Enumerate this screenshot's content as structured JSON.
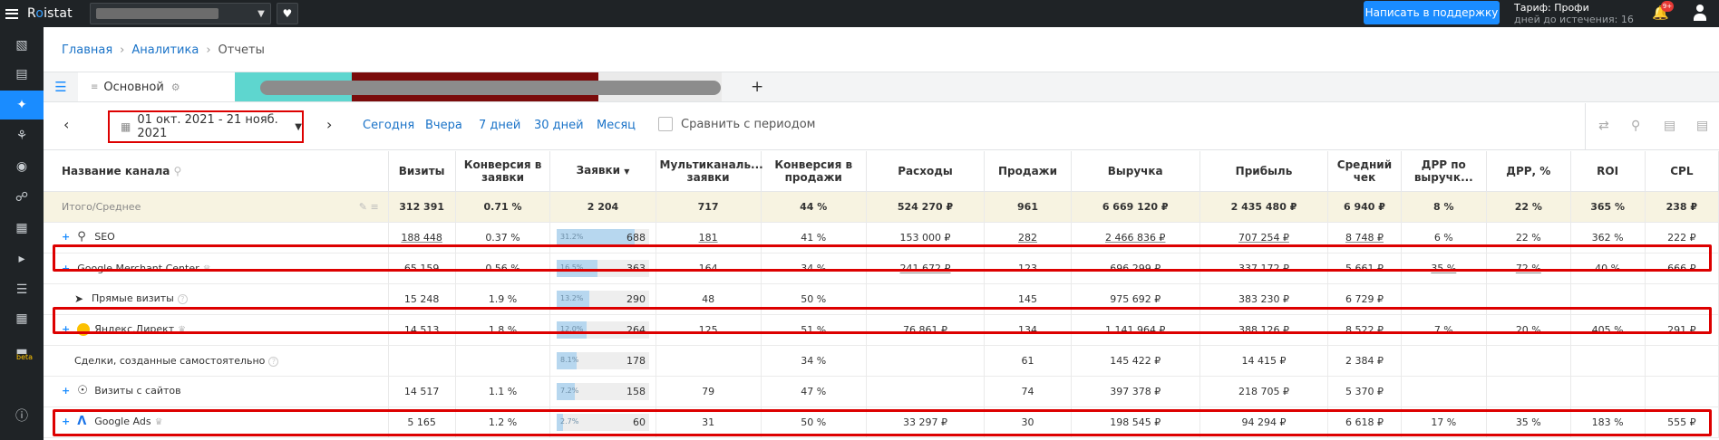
{
  "app": {
    "logo": {
      "pre": "R",
      "mid": "o",
      "post": "istat"
    },
    "support_button": "Написать в поддержку",
    "tariff_line": "Тариф: Профи",
    "tariff_sub": "дней до истечения: 16",
    "notification_badge": "9+"
  },
  "breadcrumbs": [
    "Главная",
    "Аналитика",
    "Отчеты"
  ],
  "tabs": {
    "main_tab": "Основной",
    "add": "+"
  },
  "toolbar": {
    "date_range": "01 окт. 2021 - 21 нояб. 2021",
    "presets": [
      "Сегодня",
      "Вчера",
      "7 дней",
      "30 дней",
      "Месяц"
    ],
    "compare_label": "Сравнить с периодом"
  },
  "table": {
    "headers": {
      "name": "Название канала",
      "visits": "Визиты",
      "conv_leads": "Конверсия в заявки",
      "leads": "Заявки",
      "multichannel": "Мультиканаль... заявки",
      "conv_sales": "Конверсия в продажи",
      "expenses": "Расходы",
      "sales": "Продажи",
      "revenue": "Выручка",
      "profit": "Прибыль",
      "avg_check": "Средний чек",
      "drr_rev": "ДРР по выручк...",
      "drr": "ДРР, %",
      "roi": "ROI",
      "cpl": "CPL"
    },
    "total": {
      "name": "Итого/Среднее",
      "visits": "312 391",
      "conv_leads": "0.71 %",
      "leads": "2 204",
      "multichannel": "717",
      "conv_sales": "44 %",
      "expenses": "524 270 ₽",
      "sales": "961",
      "revenue": "6 669 120 ₽",
      "profit": "2 435 480 ₽",
      "avg_check": "6 940 ₽",
      "drr_rev": "8 %",
      "drr": "22 %",
      "roi": "365 %",
      "cpl": "238 ₽"
    },
    "rows": [
      {
        "name": "SEO",
        "icon": "search-icon",
        "visits": "188 448",
        "conv_leads": "0.37 %",
        "leads_pct": "31.2%",
        "leads_fraction": 0.312,
        "leads": "688",
        "multichannel": "181",
        "conv_sales": "41 %",
        "expenses": "153 000 ₽",
        "sales": "282",
        "revenue": "2 466 836 ₽",
        "profit": "707 254 ₽",
        "avg_check": "8 748 ₽",
        "drr_rev": "6 %",
        "drr": "22 %",
        "roi": "362 %",
        "cpl": "222 ₽"
      },
      {
        "name": "Google Merchant Center",
        "icon": "",
        "visits": "65 159",
        "conv_leads": "0.56 %",
        "leads_pct": "16.5%",
        "leads_fraction": 0.165,
        "leads": "363",
        "multichannel": "164",
        "conv_sales": "34 %",
        "expenses": "241 672 ₽",
        "sales": "123",
        "revenue": "696 299 ₽",
        "profit": "337 172 ₽",
        "avg_check": "5 661 ₽",
        "drr_rev": "35 %",
        "drr": "72 %",
        "roi": "40 %",
        "cpl": "666 ₽"
      },
      {
        "name": "Прямые визиты",
        "icon": "cursor-icon",
        "visits": "15 248",
        "conv_leads": "1.9 %",
        "leads_pct": "13.2%",
        "leads_fraction": 0.132,
        "leads": "290",
        "multichannel": "48",
        "conv_sales": "50 %",
        "expenses": "",
        "sales": "145",
        "revenue": "975 692 ₽",
        "profit": "383 230 ₽",
        "avg_check": "6 729 ₽",
        "drr_rev": "",
        "drr": "",
        "roi": "",
        "cpl": ""
      },
      {
        "name": "Яндекс.Директ",
        "icon": "yandex-direct-icon",
        "visits": "14 513",
        "conv_leads": "1.8 %",
        "leads_pct": "12.0%",
        "leads_fraction": 0.12,
        "leads": "264",
        "multichannel": "125",
        "conv_sales": "51 %",
        "expenses": "76 861 ₽",
        "sales": "134",
        "revenue": "1 141 964 ₽",
        "profit": "388 126 ₽",
        "avg_check": "8 522 ₽",
        "drr_rev": "7 %",
        "drr": "20 %",
        "roi": "405 %",
        "cpl": "291 ₽"
      },
      {
        "name": "Сделки, созданные самостоятельно",
        "icon": "",
        "visits": "",
        "conv_leads": "",
        "leads_pct": "8.1%",
        "leads_fraction": 0.081,
        "leads": "178",
        "multichannel": "",
        "conv_sales": "34 %",
        "expenses": "",
        "sales": "61",
        "revenue": "145 422 ₽",
        "profit": "14 415 ₽",
        "avg_check": "2 384 ₽",
        "drr_rev": "",
        "drr": "",
        "roi": "",
        "cpl": ""
      },
      {
        "name": "Визиты с сайтов",
        "icon": "globe-icon",
        "visits": "14 517",
        "conv_leads": "1.1 %",
        "leads_pct": "7.2%",
        "leads_fraction": 0.072,
        "leads": "158",
        "multichannel": "79",
        "conv_sales": "47 %",
        "expenses": "",
        "sales": "74",
        "revenue": "397 378 ₽",
        "profit": "218 705 ₽",
        "avg_check": "5 370 ₽",
        "drr_rev": "",
        "drr": "",
        "roi": "",
        "cpl": ""
      },
      {
        "name": "Google Ads",
        "icon": "google-ads-icon",
        "visits": "5 165",
        "conv_leads": "1.2 %",
        "leads_pct": "2.7%",
        "leads_fraction": 0.027,
        "leads": "60",
        "multichannel": "31",
        "conv_sales": "50 %",
        "expenses": "33 297 ₽",
        "sales": "30",
        "revenue": "198 545 ₽",
        "profit": "94 294 ₽",
        "avg_check": "6 618 ₽",
        "drr_rev": "17 %",
        "drr": "35 %",
        "roi": "183 %",
        "cpl": "555 ₽"
      }
    ]
  },
  "sidebar_beta": "beta"
}
